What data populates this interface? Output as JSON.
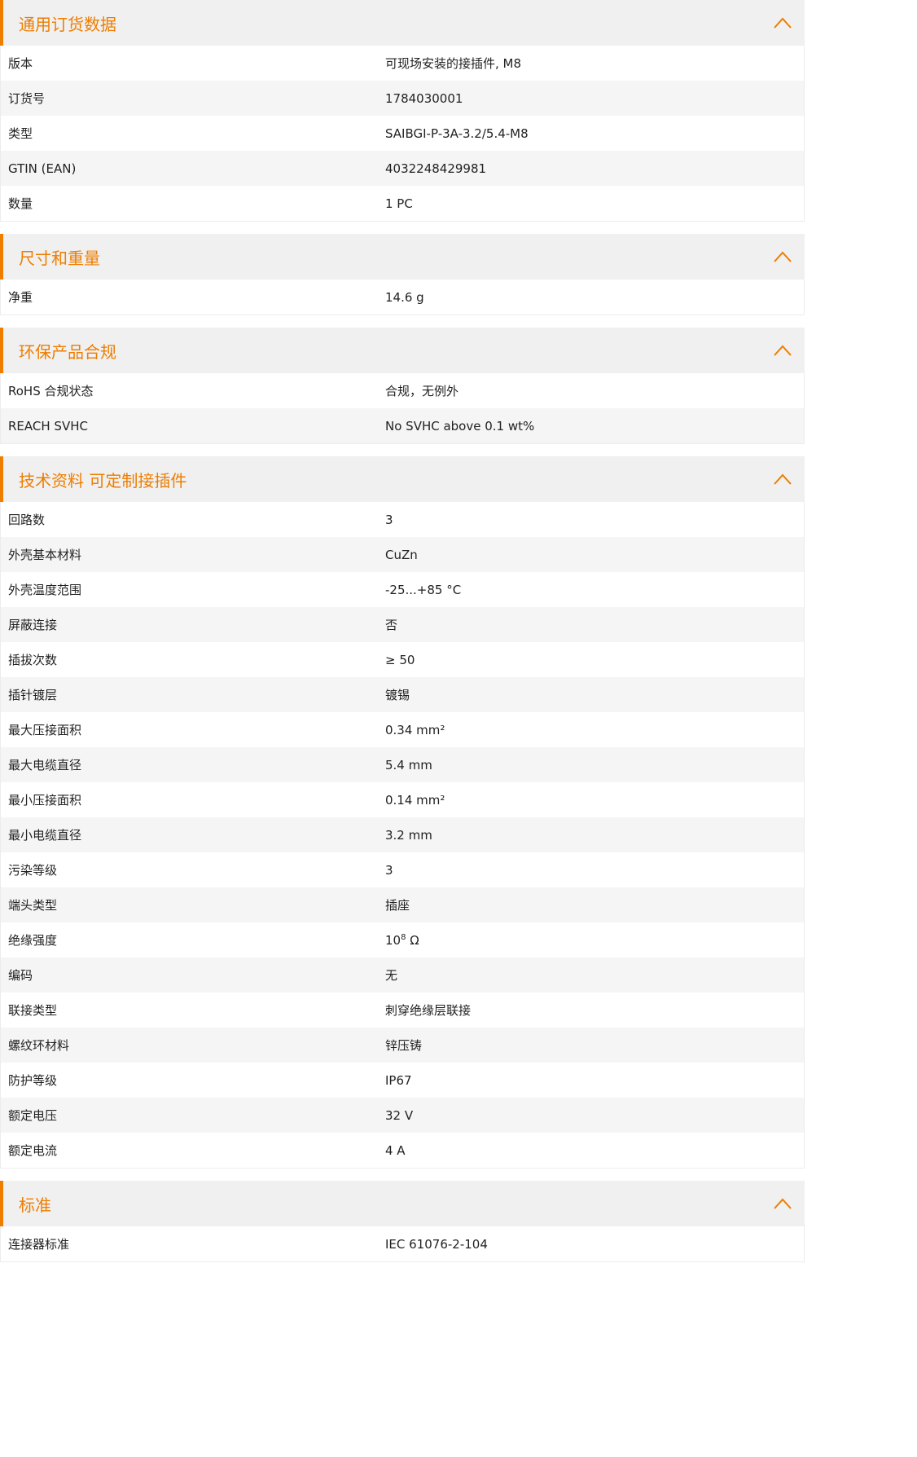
{
  "sections": [
    {
      "title": "通用订货数据",
      "rows": [
        {
          "label": "版本",
          "value": "可现场安装的接插件, M8"
        },
        {
          "label": "订货号",
          "value": "1784030001"
        },
        {
          "label": "类型",
          "value": "SAIBGI-P-3A-3.2/5.4-M8"
        },
        {
          "label": "GTIN (EAN)",
          "value": "4032248429981"
        },
        {
          "label": "数量",
          "value": "1  PC"
        }
      ]
    },
    {
      "title": "尺寸和重量",
      "rows": [
        {
          "label": "净重",
          "value": "14.6  g"
        }
      ]
    },
    {
      "title": "环保产品合规",
      "rows": [
        {
          "label": "RoHS 合规状态",
          "value": "合规，无例外"
        },
        {
          "label": "REACH SVHC",
          "value": "No SVHC above 0.1 wt%"
        }
      ]
    },
    {
      "title": "技术资料 可定制接插件",
      "rows": [
        {
          "label": "回路数",
          "value": "3"
        },
        {
          "label": "外壳基本材料",
          "value": "CuZn"
        },
        {
          "label": "外壳温度范围",
          "value": "-25...+85 °C"
        },
        {
          "label": "屏蔽连接",
          "value": "否"
        },
        {
          "label": "插拔次数",
          "value": "≥ 50"
        },
        {
          "label": "插针镀层",
          "value": "镀锡"
        },
        {
          "label": "最大压接面积",
          "value": "0.34  mm²"
        },
        {
          "label": "最大电缆直径",
          "value": "5.4  mm"
        },
        {
          "label": "最小压接面积",
          "value": "0.14  mm²"
        },
        {
          "label": "最小电缆直径",
          "value": "3.2  mm"
        },
        {
          "label": "污染等级",
          "value": "3"
        },
        {
          "label": "端头类型",
          "value": "插座"
        },
        {
          "label": "绝缘强度",
          "value": "10",
          "sup": "8",
          "suffix": " Ω"
        },
        {
          "label": "编码",
          "value": "无"
        },
        {
          "label": "联接类型",
          "value": "刺穿绝缘层联接"
        },
        {
          "label": "螺纹环材料",
          "value": "锌压铸"
        },
        {
          "label": "防护等级",
          "value": "IP67"
        },
        {
          "label": "额定电压",
          "value": "32  V"
        },
        {
          "label": "额定电流",
          "value": "4  A"
        }
      ]
    },
    {
      "title": "标准",
      "rows": [
        {
          "label": "连接器标准",
          "value": "IEC 61076-2-104"
        }
      ]
    }
  ],
  "icons": {
    "collapse": "chevron-up-icon"
  },
  "colors": {
    "accent": "#ee7d00",
    "header_bg": "#f0f0f0",
    "row_alt_bg": "#f5f5f5"
  }
}
